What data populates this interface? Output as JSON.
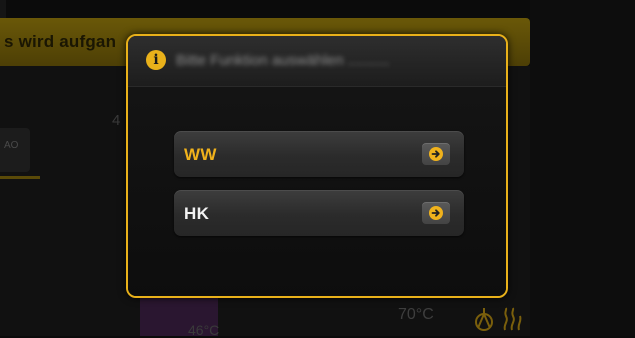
{
  "background": {
    "banner_text": "s wird aufgan",
    "left_number": "4",
    "tile_text": "AO",
    "temp_right": "70°C",
    "temp_bottom": "46°C"
  },
  "dialog": {
    "info_icon": "i",
    "title": "Bitte Funktion auswählen ..........",
    "options": [
      {
        "label": "WW",
        "arrow_icon": "arrow-right-circle-icon",
        "highlighted": true
      },
      {
        "label": "HK",
        "arrow_icon": "arrow-right-circle-icon",
        "highlighted": false
      }
    ]
  },
  "colors": {
    "accent": "#e9b11a",
    "option_highlight_text": "#f0b21c",
    "option_text": "#f2f2f2",
    "dialog_background": "#0f0f0f"
  },
  "icons": {
    "header": "info-icon",
    "status_pump": "pump-icon",
    "status_heating": "heating-icon"
  }
}
